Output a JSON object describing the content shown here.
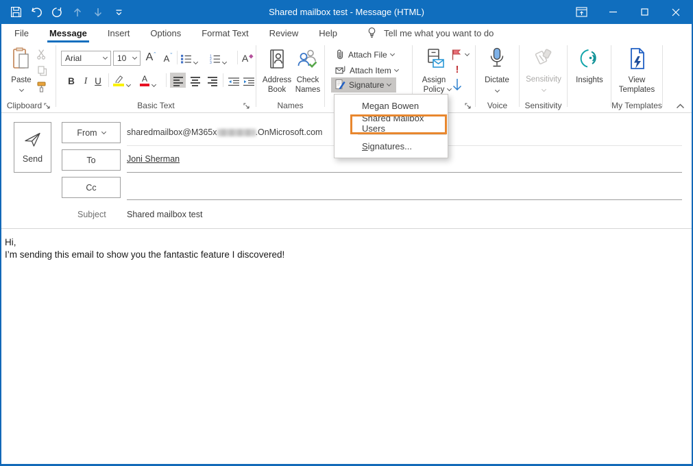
{
  "window": {
    "title": "Shared mailbox test  -  Message (HTML)"
  },
  "tabs": {
    "items": [
      "File",
      "Message",
      "Insert",
      "Options",
      "Format Text",
      "Review",
      "Help"
    ],
    "active": "Message",
    "tell_me": "Tell me what you want to do"
  },
  "ribbon": {
    "clipboard": {
      "label": "Clipboard",
      "paste": "Paste"
    },
    "basic_text": {
      "label": "Basic Text",
      "font_name": "Arial",
      "font_size": "10",
      "bold": "B",
      "italic": "I",
      "underline": "U",
      "grow_font": "A",
      "shrink_font": "A",
      "clear_format": "A",
      "font_color_letter": "A"
    },
    "names": {
      "label": "Names",
      "address_book": "Address Book",
      "check_names": "Check Names"
    },
    "include": {
      "attach_file": "Attach File",
      "attach_item": "Attach Item",
      "signature": "Signature"
    },
    "tags": {
      "assign_policy": "Assign Policy",
      "high_importance_glyph": "!"
    },
    "voice": {
      "label": "Voice",
      "dictate": "Dictate"
    },
    "sensitivity": {
      "label": "Sensitivity",
      "button": "Sensitivity"
    },
    "insights": {
      "button": "Insights"
    },
    "my_templates": {
      "label": "My Templates",
      "view_templates": "View Templates"
    }
  },
  "signature_menu": {
    "items": [
      {
        "label": "Megan Bowen",
        "highlighted": false
      },
      {
        "label": "Shared Mailbox Users",
        "highlighted": true
      },
      {
        "label": "Signatures...",
        "accelerator": "S",
        "highlighted": false
      }
    ],
    "highlight_color": "#E8872E"
  },
  "compose": {
    "send": "Send",
    "from_label": "From",
    "from_value_prefix": "sharedmailbox@M365x",
    "from_value_redacted": true,
    "from_value_suffix": ".OnMicrosoft.com",
    "to_label": "To",
    "to_value": "Joni Sherman",
    "cc_label": "Cc",
    "subject_label": "Subject",
    "subject_value": "Shared mailbox test"
  },
  "body": {
    "lines": [
      "Hi,",
      "I’m sending this email to show you the fantastic feature I discovered!"
    ]
  },
  "colors": {
    "titlebar": "#106EBE",
    "accent": "#106EBE",
    "annotation_orange": "#E8872E",
    "flag_red": "#E8707A",
    "importance_red": "#C13438",
    "low_importance_blue": "#2E80CE",
    "insights_teal": "#0A8F94",
    "highlight_yellow": "#FBF200",
    "font_color_red": "#E81123"
  }
}
